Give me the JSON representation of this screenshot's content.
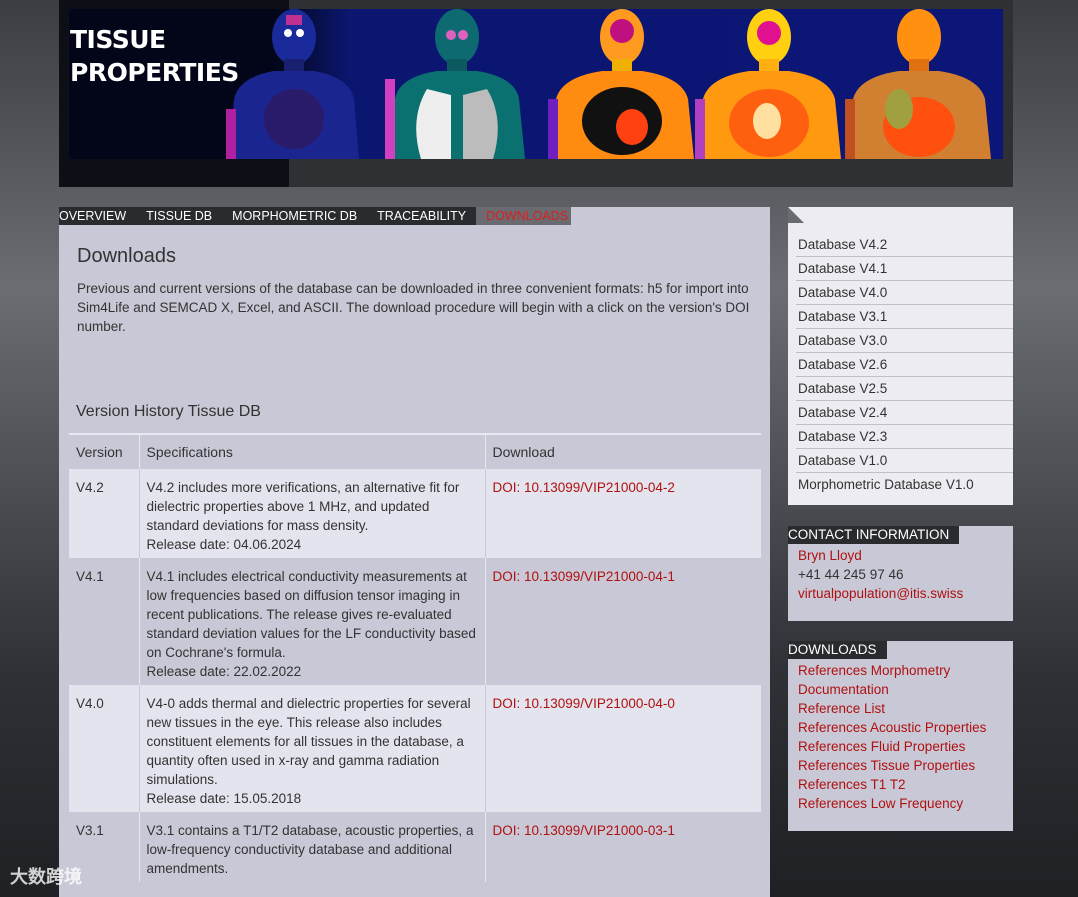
{
  "site": {
    "title_line1": "TISSUE",
    "title_line2": "PROPERTIES"
  },
  "nav": {
    "items": [
      {
        "label": "OVERVIEW"
      },
      {
        "label": "TISSUE DB"
      },
      {
        "label": "MORPHOMETRIC DB"
      },
      {
        "label": "TRACEABILITY"
      },
      {
        "label": "DOWNLOADS"
      }
    ],
    "active": "DOWNLOADS"
  },
  "main": {
    "title": "Downloads",
    "intro": "Previous and current versions of the database can be downloaded in three convenient formats: h5 for import into Sim4Life and SEMCAD X, Excel, and ASCII. The download procedure will begin with a click on the version's DOI number.",
    "section_title": "Version History Tissue DB",
    "table": {
      "headers": [
        "Version",
        "Specifications",
        "Download"
      ],
      "rows": [
        {
          "version": "V4.2",
          "spec": "V4.2 includes more verifications, an alternative fit for dielectric properties above 1 MHz, and updated standard deviations for mass density.",
          "release": "Release date: 04.06.2024",
          "doi": "DOI: 10.13099/VIP21000-04-2"
        },
        {
          "version": "V4.1",
          "spec": "V4.1 includes electrical conductivity measurements at low frequencies based on diffusion tensor imaging in recent publications. The release gives re-evaluated standard deviation values for the LF conductivity based on Cochrane's formula.",
          "release": "Release date: 22.02.2022",
          "doi": "DOI: 10.13099/VIP21000-04-1"
        },
        {
          "version": "V4.0",
          "spec": "V4-0 adds thermal and dielectric properties for several new tissues in the eye. This release also includes constituent elements for all tissues in the database, a quantity often used in x-ray and gamma radiation simulations.",
          "release": "Release date: 15.05.2018",
          "doi": "DOI: 10.13099/VIP21000-04-0"
        },
        {
          "version": "V3.1",
          "spec": "V3.1 contains a T1/T2 database, acoustic properties, a low-frequency conductivity database and additional amendments.",
          "release": "",
          "doi": "DOI: 10.13099/VIP21000-03-1"
        }
      ]
    }
  },
  "sidebar": {
    "databases": [
      "Database V4.2",
      "Database V4.1",
      "Database V4.0",
      "Database V3.1",
      "Database V3.0",
      "Database V2.6",
      "Database V2.5",
      "Database V2.4",
      "Database V2.3",
      "Database V1.0",
      "Morphometric Database V1.0"
    ],
    "contact": {
      "title": "CONTACT INFORMATION",
      "name": "Bryn Lloyd",
      "phone": "+41 44 245 97 46",
      "email": "virtualpopulation@itis.swiss"
    },
    "downloads": {
      "title": "DOWNLOADS",
      "links": [
        "References Morphometry",
        "Documentation",
        "Reference List",
        "References Acoustic Properties",
        "References Fluid Properties",
        "References Tissue Properties",
        "References T1 T2",
        "References Low Frequency"
      ]
    }
  },
  "watermark": "大数跨境",
  "colors": {
    "link": "#b01010",
    "active_nav": "#d92020",
    "panel": "#c8c8d6",
    "row_light": "#e4e4ee"
  }
}
